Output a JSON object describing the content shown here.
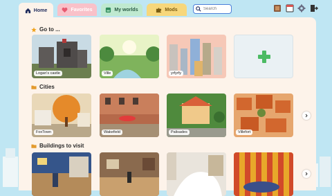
{
  "tabs": [
    {
      "label": "Home",
      "icon": "house-icon"
    },
    {
      "label": "Favorites",
      "icon": "heart-icon"
    },
    {
      "label": "My worlds",
      "icon": "world-icon"
    },
    {
      "label": "Mods",
      "icon": "puzzle-icon"
    }
  ],
  "search": {
    "placeholder": "Search"
  },
  "toolbar_icons": [
    "journal-icon",
    "window-icon",
    "gear-icon",
    "exit-icon"
  ],
  "sections": {
    "goto": {
      "title": "Go to ...",
      "icon": "star-icon"
    },
    "cities": {
      "title": "Cities",
      "icon": "folder-icon"
    },
    "buildings": {
      "title": "Buildings to visit",
      "icon": "folder-icon"
    }
  },
  "goto_cards": [
    {
      "label": "Logan's castle"
    },
    {
      "label": "Ville"
    },
    {
      "label": "yrfyrfy"
    }
  ],
  "city_cards": [
    {
      "label": "FoxTown"
    },
    {
      "label": "Wakefield"
    },
    {
      "label": "Palisades"
    },
    {
      "label": "Villefort"
    }
  ],
  "colors": {
    "accent": "#4b7fd9",
    "panel": "#fdf3ea",
    "add_green": "#4cbb63",
    "sky": "#bfe6f3"
  }
}
